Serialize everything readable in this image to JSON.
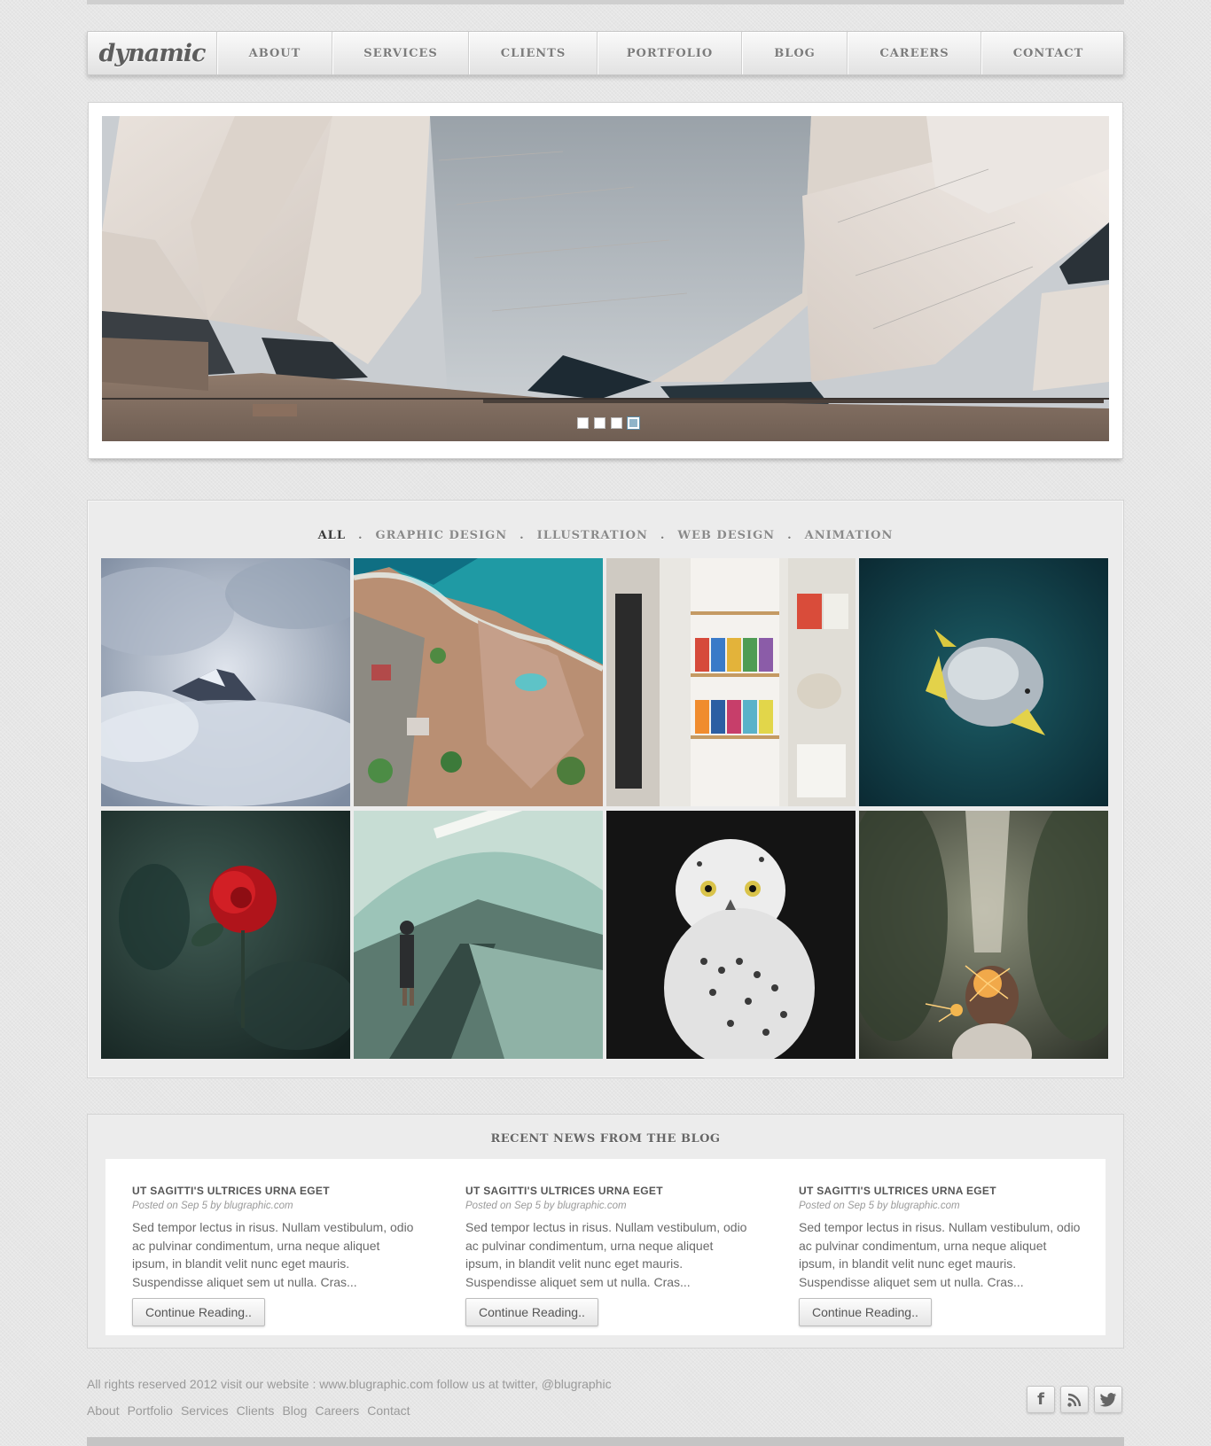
{
  "nav": {
    "logo": "dynamic",
    "items": [
      "ABOUT",
      "SERVICES",
      "CLIENTS",
      "PORTFOLIO",
      "BLOG",
      "CAREERS",
      "CONTACT"
    ]
  },
  "slider": {
    "image": "sydney-opera-house-roof",
    "dots": 4,
    "active_dot": 4
  },
  "portfolio": {
    "filters": [
      "ALL",
      "GRAPHIC DESIGN",
      "ILLUSTRATION",
      "WEB DESIGN",
      "ANIMATION"
    ],
    "active_filter": "ALL",
    "items": [
      "mountain-peak-in-clouds",
      "aerial-beach-town",
      "paint-shelves",
      "tropical-fish",
      "red-rose",
      "subway-escalator",
      "snowy-owl",
      "sparkler-girl"
    ]
  },
  "blog": {
    "title": "RECENT NEWS FROM THE BLOG",
    "posts": [
      {
        "title": "UT SAGITTI'S ULTRICES URNA EGET",
        "meta": "Posted on Sep 5 by blugraphic.com",
        "excerpt": "Sed tempor lectus in risus. Nullam vestibulum, odio ac pulvinar condimentum, urna neque aliquet ipsum, in blandit velit nunc eget mauris. Suspendisse aliquet sem ut nulla. Cras...",
        "button": "Continue Reading.."
      },
      {
        "title": "UT SAGITTI'S ULTRICES URNA EGET",
        "meta": "Posted on Sep 5 by blugraphic.com",
        "excerpt": "Sed tempor lectus in risus. Nullam vestibulum, odio ac pulvinar condimentum, urna neque aliquet ipsum, in blandit velit nunc eget mauris. Suspendisse aliquet sem ut nulla. Cras...",
        "button": "Continue Reading.."
      },
      {
        "title": "UT SAGITTI'S ULTRICES URNA EGET",
        "meta": "Posted on Sep 5 by blugraphic.com",
        "excerpt": "Sed tempor lectus in risus. Nullam vestibulum, odio ac pulvinar condimentum, urna neque aliquet ipsum, in blandit velit nunc eget mauris. Suspendisse aliquet sem ut nulla. Cras...",
        "button": "Continue Reading.."
      }
    ]
  },
  "footer": {
    "text": "All rights reserved 2012 visit our website : www.blugraphic.com follow us at twitter, @blugraphic",
    "links": [
      "About",
      "Portfolio",
      "Services",
      "Clients",
      "Blog",
      "Careers",
      "Contact"
    ],
    "social": [
      {
        "icon": "facebook-icon",
        "glyph": "f"
      },
      {
        "icon": "rss-icon",
        "glyph": ""
      },
      {
        "icon": "twitter-icon",
        "glyph": ""
      }
    ]
  }
}
